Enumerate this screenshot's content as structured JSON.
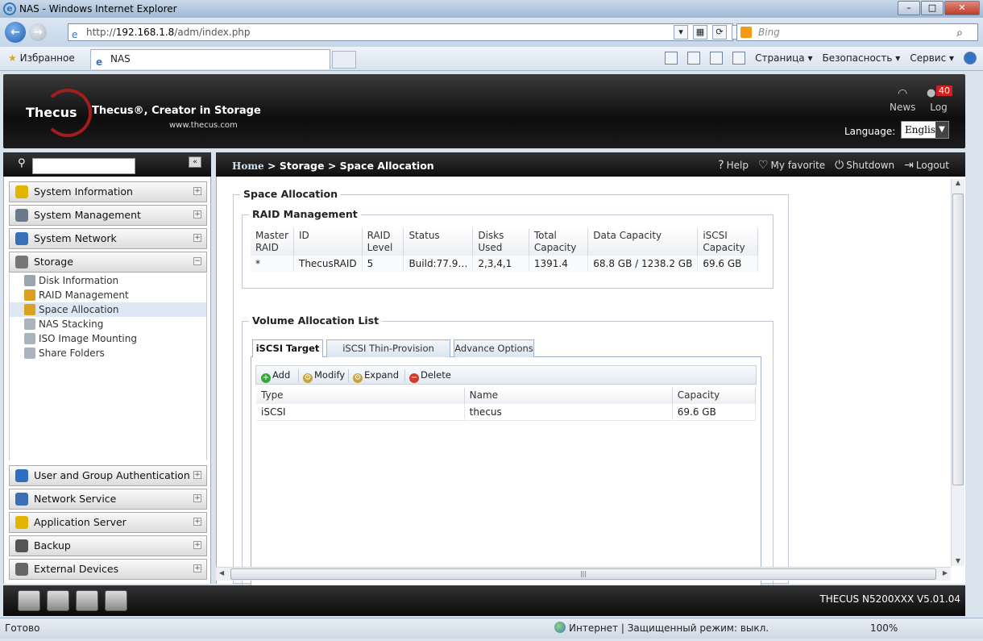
{
  "browser": {
    "title": "NAS - Windows Internet Explorer",
    "address_prefix": "http://",
    "address_host": "192.168.1.8",
    "address_path": "/adm/index.php",
    "search_placeholder": "Bing",
    "favorites_label": "Избранное",
    "tab_title": "NAS",
    "cmd_page": "Страница ▾",
    "cmd_security": "Безопасность ▾",
    "cmd_service": "Сервис ▾",
    "status_left": "Готово",
    "status_zone": "Интернет | Защищенный режим: выкл.",
    "zoom": "100%"
  },
  "header": {
    "brand": "Thecus",
    "tagline": "Thecus®, Creator in Storage",
    "site": "www.thecus.com",
    "news_label": "News",
    "log_label": "Log",
    "log_count": "40",
    "language_label": "Language:",
    "language_value": "English"
  },
  "sidebar": {
    "sections_top": [
      {
        "label": "System Information",
        "icon": "info-icon",
        "color": "#e2b400"
      },
      {
        "label": "System Management",
        "icon": "tools-icon",
        "color": "#6b7a8a"
      },
      {
        "label": "System Network",
        "icon": "network-icon",
        "color": "#3a6fb5"
      },
      {
        "label": "Storage",
        "icon": "storage-icon",
        "color": "#777777"
      }
    ],
    "storage_items": [
      {
        "label": "Disk Information"
      },
      {
        "label": "RAID Management"
      },
      {
        "label": "Space Allocation",
        "active": true
      },
      {
        "label": "NAS Stacking"
      },
      {
        "label": "ISO Image Mounting"
      },
      {
        "label": "Share Folders"
      }
    ],
    "sections_bottom": [
      {
        "label": "User and Group Authentication",
        "icon": "users-icon",
        "color": "#2f6fc0"
      },
      {
        "label": "Network Service",
        "icon": "network-service-icon",
        "color": "#3a6fb5"
      },
      {
        "label": "Application Server",
        "icon": "app-server-icon",
        "color": "#e2b400"
      },
      {
        "label": "Backup",
        "icon": "backup-icon",
        "color": "#555555"
      },
      {
        "label": "External Devices",
        "icon": "external-devices-icon",
        "color": "#666666"
      }
    ]
  },
  "breadcrumb": {
    "home": "Home",
    "sep1": " > ",
    "storage": "Storage",
    "sep2": " > ",
    "current": "Space Allocation"
  },
  "top_actions": {
    "help": "Help",
    "favorite": "My favorite",
    "shutdown": "Shutdown",
    "logout": "Logout"
  },
  "space_allocation": {
    "title": "Space Allocation",
    "raid_title": "RAID Management",
    "raid_columns": [
      "Master RAID",
      "ID",
      "RAID Level",
      "Status",
      "Disks Used",
      "Total Capacity",
      "Data Capacity",
      "iSCSI Capacity"
    ],
    "raid_rows": [
      [
        "*",
        "ThecusRAID",
        "5",
        "Build:77.9…",
        "2,3,4,1",
        "1391.4",
        "68.8 GB / 1238.2 GB",
        "69.6 GB"
      ]
    ],
    "volume_title": "Volume Allocation List",
    "tabs": [
      "iSCSI Target",
      "iSCSI Thin-Provision Targets",
      "Advance Options"
    ],
    "toolbar": {
      "add": "Add",
      "modify": "Modify",
      "expand": "Expand",
      "delete": "Delete"
    },
    "volume_columns": [
      "Type",
      "Name",
      "Capacity"
    ],
    "volume_rows": [
      [
        "iSCSI",
        "thecus",
        "69.6 GB"
      ]
    ]
  },
  "footer": {
    "model": "THECUS N5200XXX V5.01.04"
  },
  "colors": {
    "accent": "#2f75c6",
    "header_bg": "#0d0d0d",
    "badge": "#d21f1f"
  }
}
